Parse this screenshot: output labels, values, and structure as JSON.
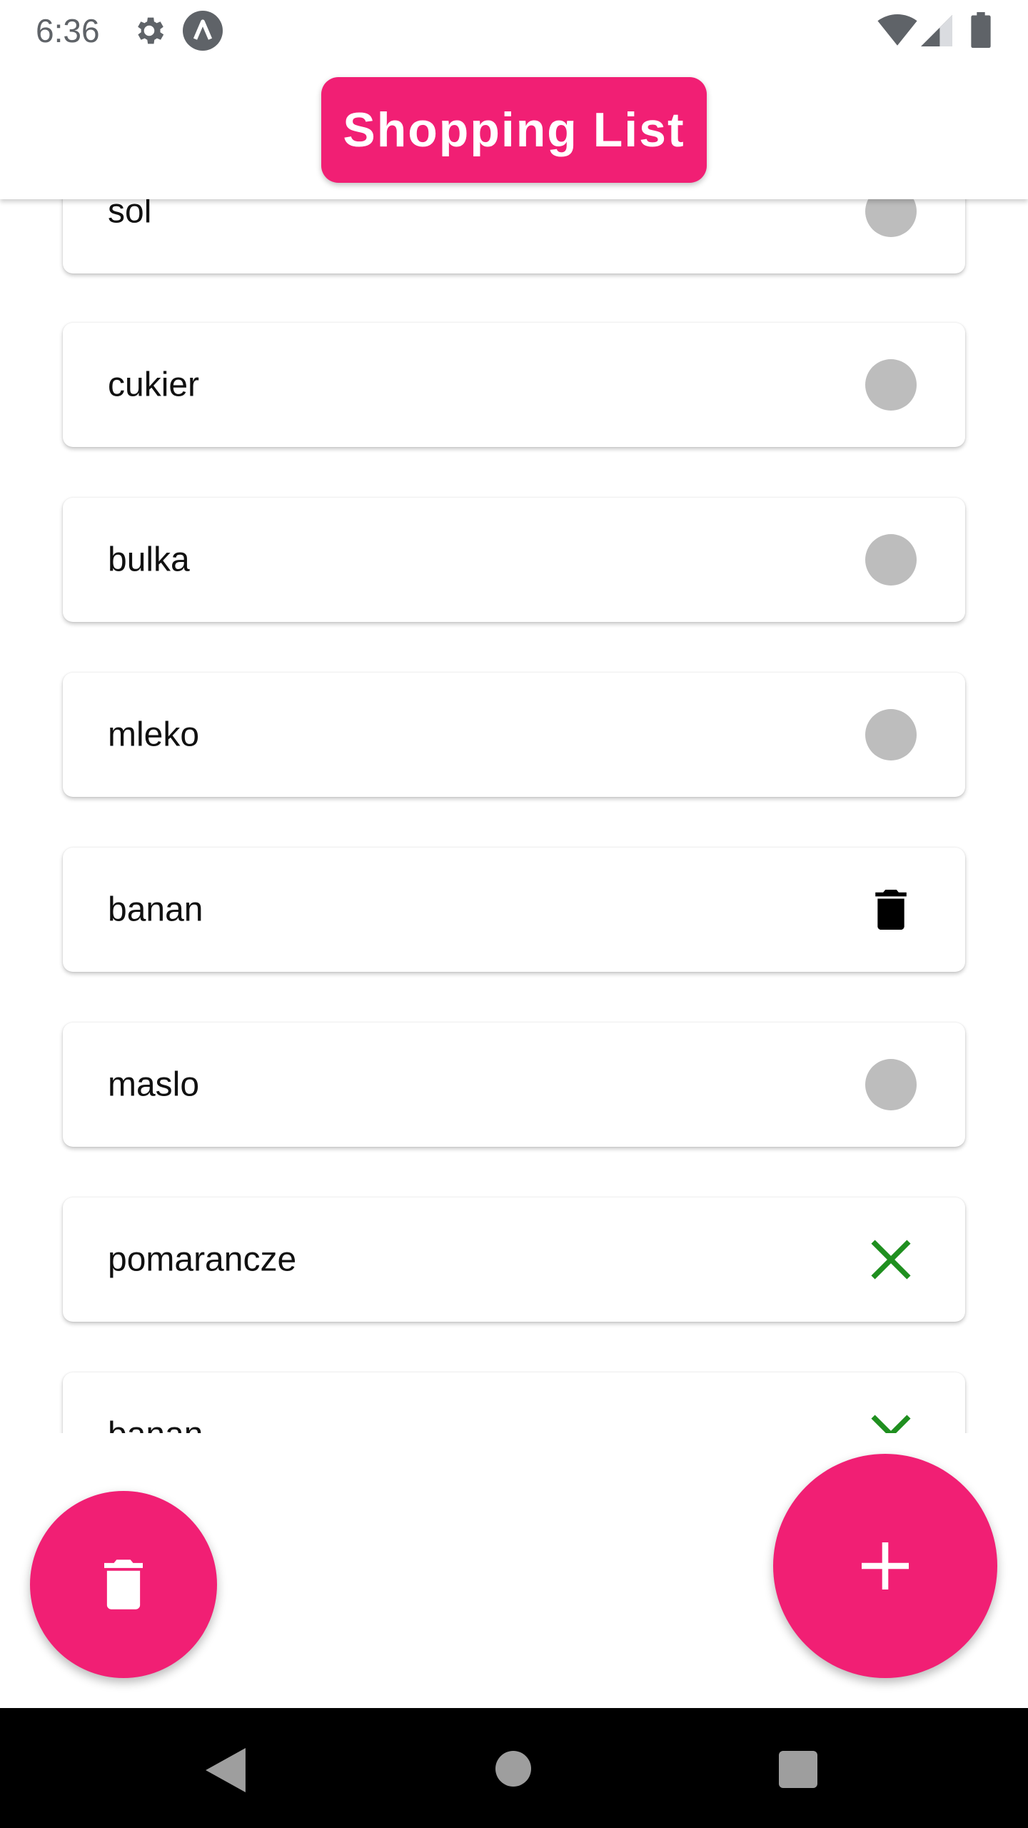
{
  "status_bar": {
    "time": "6:36",
    "icons": [
      "gear-icon",
      "a-circle-icon",
      "wifi-icon",
      "signal-icon",
      "battery-icon"
    ]
  },
  "header": {
    "title": "Shopping List"
  },
  "list": {
    "items": [
      {
        "label": "sol",
        "action": "circle-toggle"
      },
      {
        "label": "cukier",
        "action": "circle-toggle"
      },
      {
        "label": "bulka",
        "action": "circle-toggle"
      },
      {
        "label": "mleko",
        "action": "circle-toggle"
      },
      {
        "label": "banan",
        "action": "trash-icon"
      },
      {
        "label": "maslo",
        "action": "circle-toggle"
      },
      {
        "label": "pomarancze",
        "action": "close-icon"
      },
      {
        "label": "banan",
        "action": "close-icon"
      }
    ]
  },
  "fabs": {
    "delete": "trash-icon",
    "add": "plus-icon"
  },
  "colors": {
    "accent": "#f11f74",
    "toggle_grey": "#bdbdbd",
    "close_green": "#1f8f1f",
    "nav_bg": "#000000",
    "nav_icon": "#9e9e9e"
  },
  "nav_bar": {
    "icons": [
      "back-icon",
      "home-icon",
      "recents-icon"
    ]
  }
}
